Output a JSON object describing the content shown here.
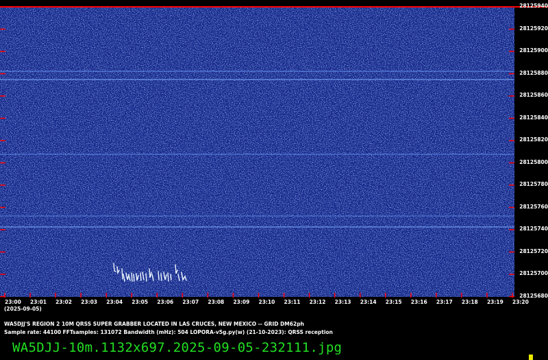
{
  "spectrogram": {
    "y_axis_labels": [
      "28125940",
      "28125920",
      "28125900",
      "28125880",
      "28125860",
      "28125840",
      "28125820",
      "28125800",
      "28125780",
      "28125760",
      "28125740",
      "28125720",
      "28125700",
      "28125680"
    ],
    "x_axis_labels": [
      "23:00",
      "23:01",
      "23:02",
      "23:03",
      "23:04",
      "23:05",
      "23:06",
      "23:07",
      "23:08",
      "23:09",
      "23:10",
      "23:11",
      "23:12",
      "23:13",
      "23:14",
      "23:15",
      "23:16",
      "23:17",
      "23:18",
      "23:19",
      "23:20"
    ],
    "date_label": "(2025-09-05)",
    "colors": {
      "background": "#16288a",
      "noise": "#4a78e0",
      "frame_top": "#ff0000",
      "tick_marks": "#ff0000",
      "signal": "#f0f8ff"
    }
  },
  "info": {
    "station_line": "WA5DJJ'S REGION 2 10M QRSS SUPER GRABBER LOCATED IN LAS CRUCES, NEW MEXICO -- GRID DM62ph",
    "params_line": "Sample rate: 44100    FFTsamples: 131072    Bandwidth (mHz): 504        LOPORA-v5g.py(w) (21-10-2023): QRSS reception"
  },
  "filename": "WA5DJJ-10m.1132x697.2025-09-05-232111.jpg"
}
